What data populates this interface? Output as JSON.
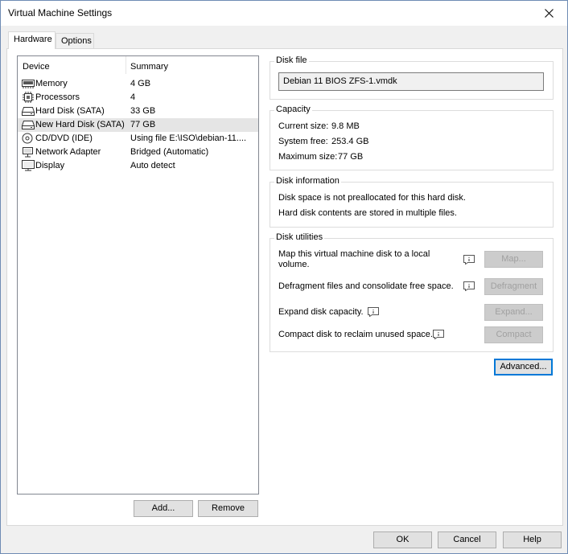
{
  "window": {
    "title": "Virtual Machine Settings"
  },
  "tabs": [
    {
      "label": "Hardware"
    },
    {
      "label": "Options"
    }
  ],
  "device_list": {
    "headers": {
      "device": "Device",
      "summary": "Summary"
    },
    "rows": [
      {
        "device": "Memory",
        "summary": "4 GB",
        "icon": "memory-icon"
      },
      {
        "device": "Processors",
        "summary": "4",
        "icon": "processor-icon"
      },
      {
        "device": "Hard Disk (SATA)",
        "summary": "33 GB",
        "icon": "hard-disk-icon"
      },
      {
        "device": "New Hard Disk (SATA)",
        "summary": "77 GB",
        "icon": "hard-disk-icon"
      },
      {
        "device": "CD/DVD (IDE)",
        "summary": "Using file E:\\ISO\\debian-11....",
        "icon": "cd-dvd-icon"
      },
      {
        "device": "Network Adapter",
        "summary": "Bridged (Automatic)",
        "icon": "network-adapter-icon"
      },
      {
        "device": "Display",
        "summary": "Auto detect",
        "icon": "display-icon"
      }
    ],
    "add_label": "Add...",
    "remove_label": "Remove"
  },
  "disk_file": {
    "title": "Disk file",
    "value": "Debian 11 BIOS ZFS-1.vmdk"
  },
  "capacity": {
    "title": "Capacity",
    "current_size_label": "Current size:",
    "current_size": "9.8 MB",
    "system_free_label": "System free:",
    "system_free": "253.4 GB",
    "maximum_size_label": "Maximum size:",
    "maximum_size": "77 GB"
  },
  "disk_information": {
    "title": "Disk information",
    "line1": "Disk space is not preallocated for this hard disk.",
    "line2": "Hard disk contents are stored in multiple files."
  },
  "disk_utilities": {
    "title": "Disk utilities",
    "map_text_1": "Map this virtual machine disk to a local",
    "map_text_2": "volume.",
    "map_label": "Map...",
    "defrag_text": "Defragment files and consolidate free space.",
    "defrag_label": "Defragment",
    "expand_text": "Expand disk capacity.",
    "expand_label": "Expand...",
    "compact_text": "Compact disk to reclaim unused space.",
    "compact_label": "Compact"
  },
  "advanced_label": "Advanced...",
  "footer": {
    "ok_label": "OK",
    "cancel_label": "Cancel",
    "help_label": "Help"
  },
  "colors": {
    "selection": "#e5e5e5",
    "default_button_border": "#0078d7",
    "disabled_text": "#a0a0a0"
  }
}
